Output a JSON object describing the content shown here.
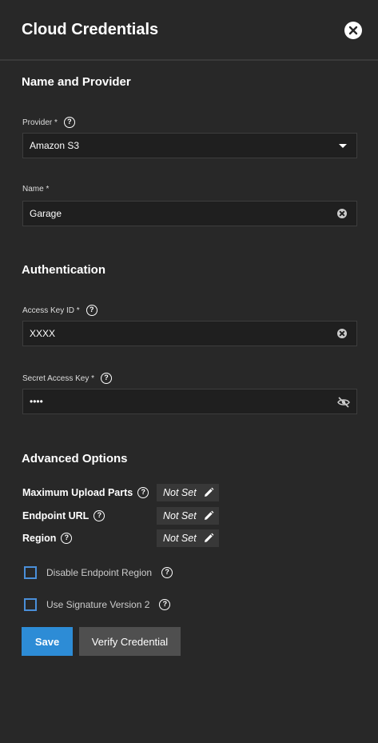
{
  "header": {
    "title": "Cloud Credentials"
  },
  "sections": {
    "name_provider": "Name and Provider",
    "authentication": "Authentication",
    "advanced": "Advanced Options"
  },
  "fields": {
    "provider": {
      "label": "Provider *",
      "value": "Amazon S3"
    },
    "name": {
      "label": "Name *",
      "value": "Garage"
    },
    "access_key": {
      "label": "Access Key ID *",
      "value": "XXXX"
    },
    "secret_key": {
      "label": "Secret Access Key *",
      "value": "••••"
    }
  },
  "advanced": {
    "items": [
      {
        "label": "Maximum Upload Parts",
        "value": "Not Set"
      },
      {
        "label": "Endpoint URL",
        "value": "Not Set"
      },
      {
        "label": "Region",
        "value": "Not Set"
      }
    ],
    "checkboxes": [
      {
        "label": "Disable Endpoint Region",
        "checked": false
      },
      {
        "label": "Use Signature Version 2",
        "checked": false
      }
    ]
  },
  "buttons": {
    "save": "Save",
    "verify": "Verify Credential"
  },
  "colors": {
    "primary": "#2d8cd6",
    "background": "#282828",
    "input_bg": "#1f1f1f",
    "secondary_button": "#4f4f4f"
  }
}
